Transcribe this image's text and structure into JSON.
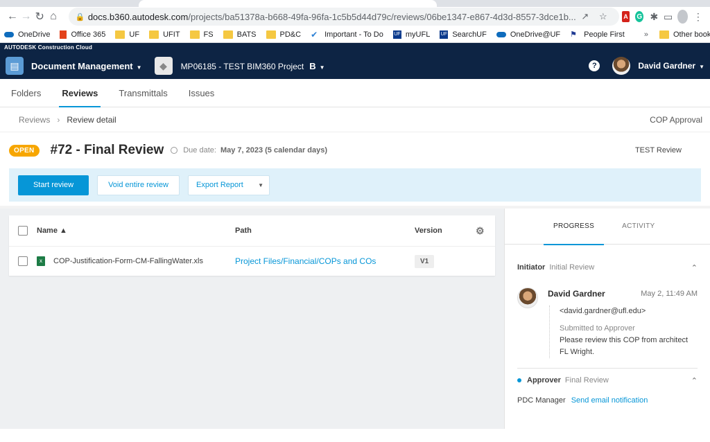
{
  "browser": {
    "url_host": "docs.b360.autodesk.com",
    "url_rest": "/projects/ba51378a-b668-49fa-96fa-1c5b5d44d79c/reviews/06be1347-e867-4d3d-8557-3dce1b...",
    "bookmarks": [
      "OneDrive",
      "Office 365",
      "UF",
      "UFIT",
      "FS",
      "BATS",
      "PD&C",
      "Important - To Do",
      "myUFL",
      "SearchUF",
      "OneDrive@UF",
      "People First"
    ],
    "bookmarks_more": "»",
    "other_bookmarks": "Other bookmarks"
  },
  "app": {
    "brand": "AUTODESK Construction Cloud",
    "module": "Document Management",
    "project": "MP06185 - TEST BIM360 Project",
    "project_badge": "B",
    "user_name": "David Gardner",
    "help": "?"
  },
  "tabs": [
    "Folders",
    "Reviews",
    "Transmittals",
    "Issues"
  ],
  "breadcrumb": {
    "root": "Reviews",
    "current": "Review detail",
    "workflow": "COP Approval"
  },
  "review": {
    "status": "OPEN",
    "title": "#72 - Final Review",
    "due_label": "Due date:",
    "due_value": "May 7, 2023 (5 calendar days)",
    "type": "TEST Review"
  },
  "actions": {
    "start": "Start review",
    "void": "Void entire review",
    "export": "Export Report"
  },
  "table": {
    "headers": {
      "name": "Name",
      "path": "Path",
      "version": "Version"
    },
    "rows": [
      {
        "name": "COP-Justification-Form-CM-FallingWater.xls",
        "path": "Project Files/Financial/COPs and COs",
        "version": "V1"
      }
    ]
  },
  "panel": {
    "tabs": [
      "PROGRESS",
      "ACTIVITY"
    ],
    "initiator": {
      "label": "Initiator",
      "step": "Initial Review",
      "name": "David Gardner",
      "time": "May 2, 11:49 AM",
      "email": "<david.gardner@ufl.edu>",
      "status": "Submitted to Approver",
      "comment": "Please review this COP from architect FL Wright."
    },
    "approver": {
      "label": "Approver",
      "step": "Final Review",
      "assignee": "PDC Manager",
      "action": "Send email notification"
    }
  }
}
